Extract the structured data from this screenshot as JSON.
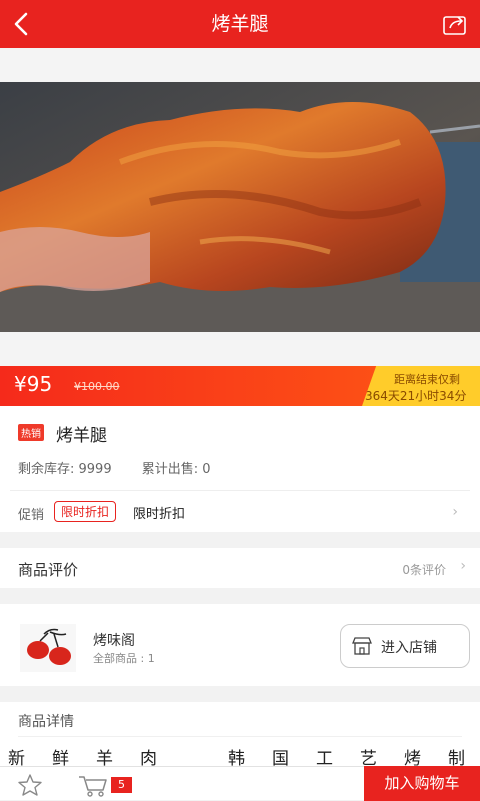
{
  "header": {
    "title": "烤羊腿",
    "back_icon": "back-icon",
    "share_icon": "share-icon"
  },
  "product": {
    "price": "¥95",
    "original_price": "¥100.00",
    "countdown_label": "距离结束仅剩",
    "countdown_value": "364天21小时34分",
    "hot_tag": "热销",
    "name": "烤羊腿",
    "stock": "剩余库存: 9999",
    "sold": "累计出售: 0",
    "promo_label": "促销",
    "promo_tag": "限时折扣",
    "promo_text": "限时折扣"
  },
  "reviews": {
    "label": "商品评价",
    "count": "0条评价"
  },
  "shop": {
    "name": "烤味阁",
    "product_count": "全部商品 : 1",
    "enter_label": "进入店铺"
  },
  "details": {
    "label": "商品详情",
    "text": [
      "新",
      "鲜",
      "羊",
      "肉",
      "",
      "韩",
      "国",
      "工",
      "艺",
      "烤",
      "制"
    ]
  },
  "footer": {
    "cart_count": "5",
    "add_to_cart": "加入购物车"
  },
  "colors": {
    "brand_red": "#e8231f",
    "countdown_bg": "#ffcc2a"
  }
}
